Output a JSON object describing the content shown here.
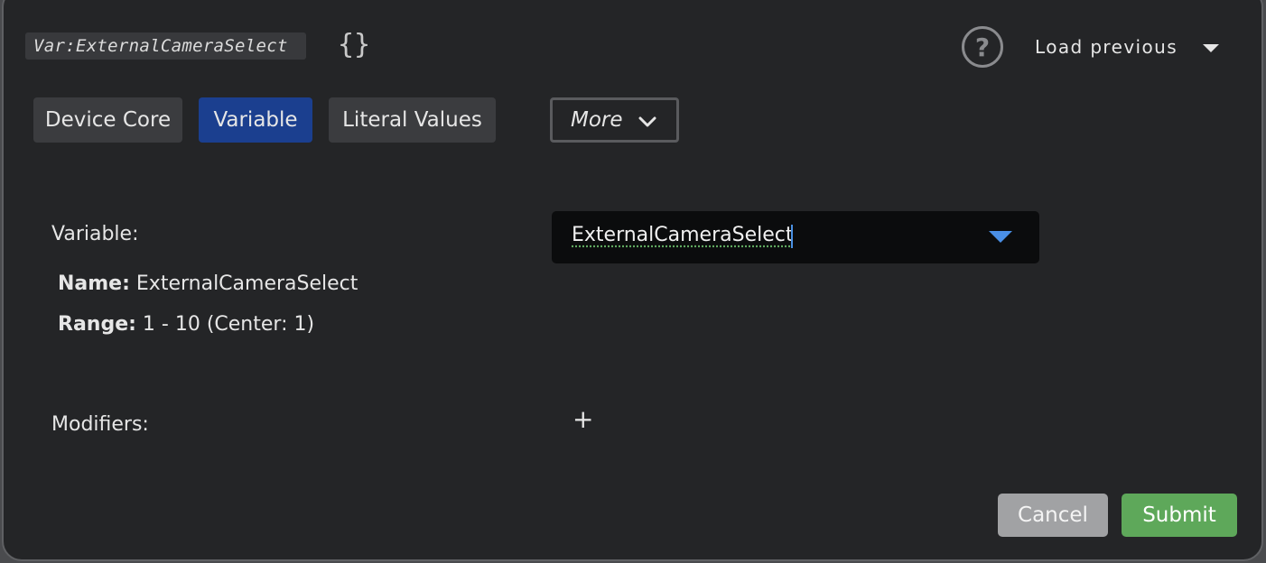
{
  "header": {
    "expression_tag": "Var:ExternalCameraSelect",
    "braces_symbol": "{}",
    "help_symbol": "?",
    "load_previous_label": "Load previous"
  },
  "tabs": [
    {
      "label": "Device Core",
      "active": false
    },
    {
      "label": "Variable",
      "active": true
    },
    {
      "label": "Literal Values",
      "active": false
    }
  ],
  "more_label": "More",
  "form": {
    "variable_label": "Variable:",
    "variable_value": "ExternalCameraSelect",
    "name_label": "Name:",
    "name_value": "ExternalCameraSelect",
    "range_label": "Range:",
    "range_value": "1 - 10 (Center: 1)",
    "modifiers_label": "Modifiers:",
    "add_modifier_symbol": "+"
  },
  "actions": {
    "cancel_label": "Cancel",
    "submit_label": "Submit"
  },
  "colors": {
    "dialog_bg": "#242527",
    "active_tab": "#1b3f8f",
    "submit": "#5ea85a",
    "cancel": "#a1a2a4",
    "dropdown_caret": "#4a8fe6"
  }
}
